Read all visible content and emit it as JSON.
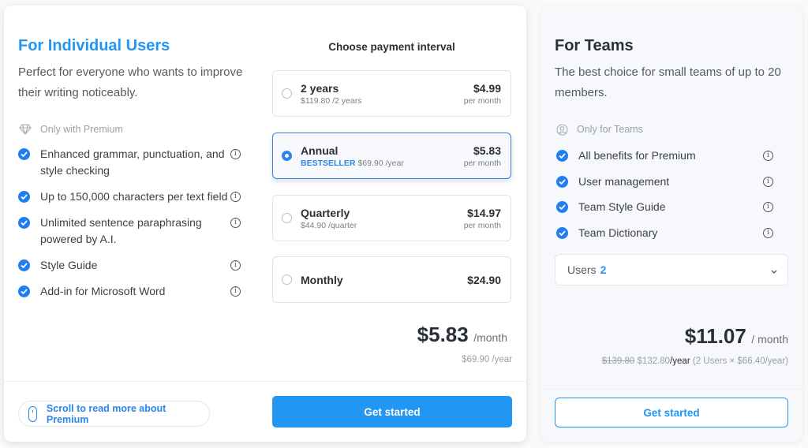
{
  "colors": {
    "accent": "#2196f3",
    "selected_border": "#2a86ee",
    "text_primary": "#2b2f36",
    "text_muted": "#9aa0a8"
  },
  "individual": {
    "title": "For Individual Users",
    "subtitle": "Perfect for everyone who wants to improve their writing noticeably.",
    "section_label": "Only with Premium",
    "section_icon": "diamond-icon",
    "features": [
      {
        "label": "Enhanced grammar, punctuation, and style checking",
        "icon": "check-circle-icon",
        "info_icon": "info-icon"
      },
      {
        "label": "Up to 150,000 characters per text field",
        "icon": "check-circle-icon",
        "info_icon": "info-icon"
      },
      {
        "label": "Unlimited sentence paraphrasing powered by A.I.",
        "icon": "check-circle-icon",
        "info_icon": "info-icon"
      },
      {
        "label": "Style Guide",
        "icon": "check-circle-icon",
        "info_icon": "info-icon"
      },
      {
        "label": "Add-in for Microsoft Word",
        "icon": "check-circle-icon",
        "info_icon": "info-icon"
      }
    ],
    "interval_title": "Choose payment interval",
    "options": [
      {
        "name": "2 years",
        "badge": "",
        "sub": "$119.80 /2 years",
        "price": "$4.99",
        "per": "per month",
        "selected": false
      },
      {
        "name": "Annual",
        "badge": "BESTSELLER",
        "sub": "$69.90 /year",
        "price": "$5.83",
        "per": "per month",
        "selected": true
      },
      {
        "name": "Quarterly",
        "badge": "",
        "sub": "$44.90 /quarter",
        "price": "$14.97",
        "per": "per month",
        "selected": false
      },
      {
        "name": "Monthly",
        "badge": "",
        "sub": "",
        "price": "$24.90",
        "per": "",
        "selected": false
      }
    ],
    "total_price": "$5.83",
    "total_unit": "/month",
    "total_yearly": "$69.90 /year",
    "scroll_hint": "Scroll to read more about Premium",
    "scroll_icon": "mouse-icon",
    "cta": "Get started"
  },
  "teams": {
    "title": "For Teams",
    "subtitle": "The best choice for small teams of up to 20 members.",
    "section_label": "Only for Teams",
    "section_icon": "user-circle-icon",
    "features": [
      {
        "label": "All benefits for Premium",
        "icon": "check-circle-icon",
        "info_icon": "info-icon"
      },
      {
        "label": "User management",
        "icon": "check-circle-icon",
        "info_icon": "info-icon"
      },
      {
        "label": "Team Style Guide",
        "icon": "check-circle-icon",
        "info_icon": "info-icon"
      },
      {
        "label": "Team Dictionary",
        "icon": "check-circle-icon",
        "info_icon": "info-icon"
      }
    ],
    "users_select": {
      "label": "Users",
      "value": "2"
    },
    "total_price": "$11.07",
    "total_unit": "/ month",
    "old_price": "$139.80",
    "new_price": "$132.80",
    "per_year": "/year",
    "breakdown": "(2 Users × $66.40/year)",
    "cta": "Get started"
  }
}
